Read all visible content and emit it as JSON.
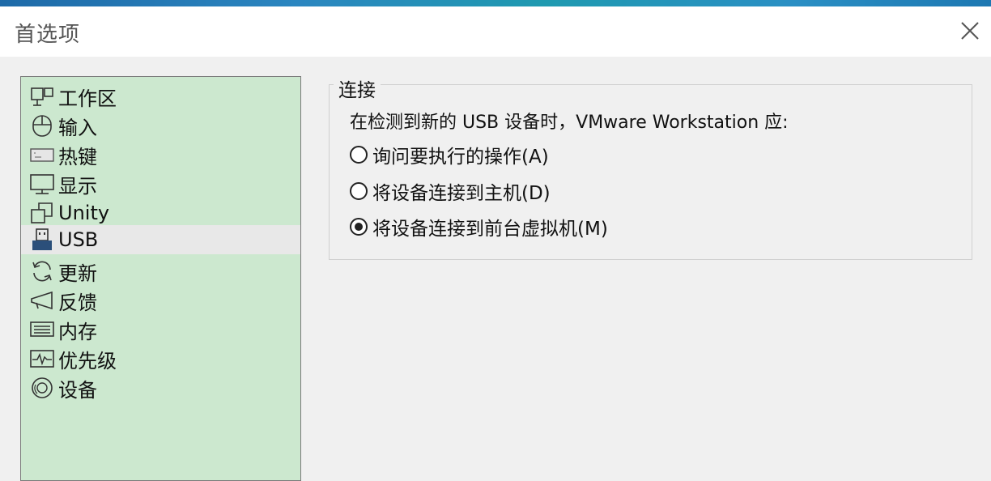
{
  "window": {
    "title": "首选项",
    "close_icon": "close-icon"
  },
  "colors": {
    "sidebar_bg": "#cce8cf",
    "selected_bg": "#e8e8e8",
    "window_bg": "#f0f0f0"
  },
  "sidebar": {
    "items": [
      {
        "label": "工作区",
        "icon": "workspace-icon"
      },
      {
        "label": "输入",
        "icon": "mouse-icon"
      },
      {
        "label": "热键",
        "icon": "keyboard-icon"
      },
      {
        "label": "显示",
        "icon": "monitor-icon"
      },
      {
        "label": "Unity",
        "icon": "unity-windows-icon"
      },
      {
        "label": "USB",
        "icon": "usb-icon",
        "selected": true
      },
      {
        "label": "更新",
        "icon": "refresh-icon"
      },
      {
        "label": "反馈",
        "icon": "megaphone-icon"
      },
      {
        "label": "内存",
        "icon": "memory-icon"
      },
      {
        "label": "优先级",
        "icon": "priority-chart-icon"
      },
      {
        "label": "设备",
        "icon": "device-disc-icon"
      }
    ]
  },
  "connection": {
    "group_title": "连接",
    "prompt": "在检测到新的 USB 设备时，VMware Workstation 应:",
    "options": [
      {
        "label": "询问要执行的操作(A)",
        "checked": false
      },
      {
        "label": "将设备连接到主机(D)",
        "checked": false
      },
      {
        "label": "将设备连接到前台虚拟机(M)",
        "checked": true
      }
    ]
  }
}
